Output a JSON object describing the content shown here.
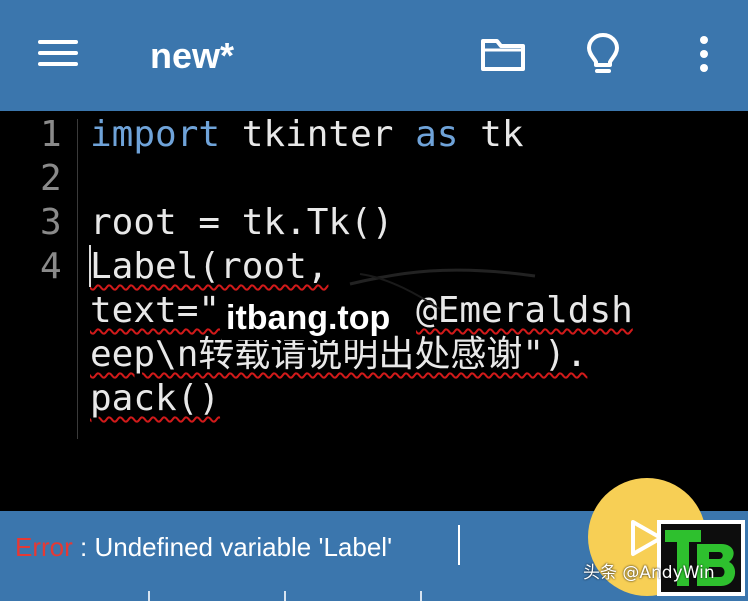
{
  "header": {
    "title": "new*",
    "background": "#3b76ad",
    "icons": [
      "menu-icon",
      "folder-icon",
      "lightbulb-icon",
      "more-vert-icon"
    ]
  },
  "editor": {
    "line_numbers": [
      "1",
      "2",
      "3",
      "4"
    ],
    "lines": {
      "l1_kw1": "import",
      "l1_mid": " tkinter ",
      "l1_kw2": "as",
      "l1_end": " tk",
      "l3": "root = tk.Tk()",
      "l4a": "Label(root,",
      "l4b_a": "text=\"",
      "l4b_b": "@Emeraldsh",
      "l4c": "eep\\n转载请说明出处感谢\").",
      "l4d": "pack()"
    },
    "keyword_color": "#6fa3d9",
    "error_underline_color": "#d11a1a"
  },
  "watermark": "itbang.top",
  "status": {
    "error_label": "Error",
    "message": " : Undefined variable 'Label'",
    "error_color": "#e53935"
  },
  "fab": {
    "icon": "play-icon",
    "color": "#f7cf55"
  },
  "logo": {
    "text": "TB"
  },
  "credit": "头条 @AndyWin"
}
